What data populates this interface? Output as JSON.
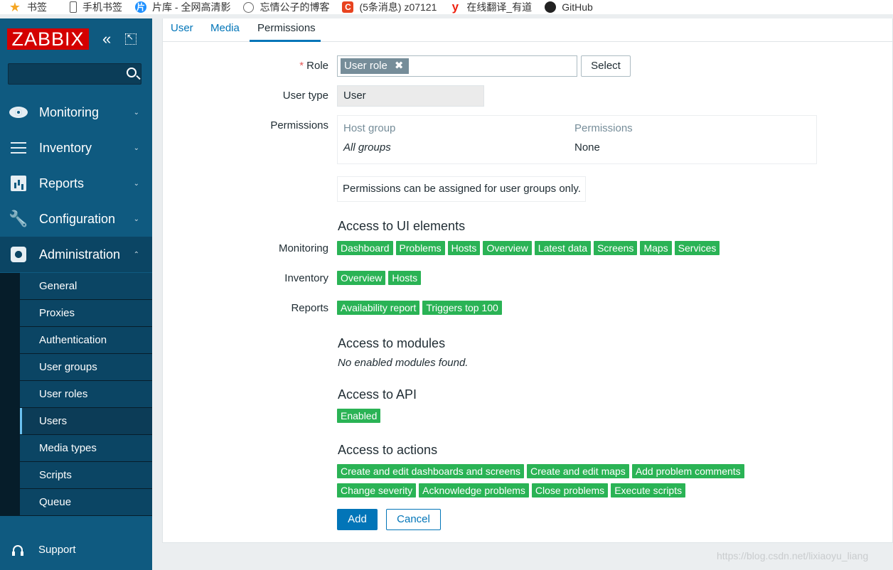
{
  "bookmarks": [
    {
      "label": "书签",
      "icon": "star-icon"
    },
    {
      "label": "手机书签",
      "icon": "phone-icon"
    },
    {
      "label": "片库 - 全网高清影",
      "icon": "piankul-icon"
    },
    {
      "label": "忘情公子的博客",
      "icon": "globe-icon"
    },
    {
      "label": "(5条消息) z07121",
      "icon": "csdn-icon"
    },
    {
      "label": "在线翻译_有道",
      "icon": "youdao-icon"
    },
    {
      "label": "GitHub",
      "icon": "github-icon"
    }
  ],
  "sidebar": {
    "logo": "ZABBIX",
    "collapse_glyph": "«",
    "menu": [
      {
        "label": "Monitoring",
        "icon": "eye-icon"
      },
      {
        "label": "Inventory",
        "icon": "list-icon"
      },
      {
        "label": "Reports",
        "icon": "bar-chart-icon"
      },
      {
        "label": "Configuration",
        "icon": "wrench-icon"
      },
      {
        "label": "Administration",
        "icon": "gear-icon"
      }
    ],
    "chevron_down": "⌄",
    "chevron_up": "⌃",
    "submenu": [
      "General",
      "Proxies",
      "Authentication",
      "User groups",
      "User roles",
      "Users",
      "Media types",
      "Scripts",
      "Queue"
    ],
    "selected_submenu": "Users",
    "support": "Support"
  },
  "tabs": [
    "User",
    "Media",
    "Permissions"
  ],
  "active_tab": "Permissions",
  "form": {
    "role_label": "Role",
    "role_required": "*",
    "role_value": "User role",
    "role_remove": "✖",
    "select_button": "Select",
    "user_type_label": "User type",
    "user_type_value": "User",
    "permissions_label": "Permissions",
    "perm_headers": [
      "Host group",
      "Permissions"
    ],
    "perm_row": [
      "All groups",
      "None"
    ],
    "note": "Permissions can be assigned for user groups only."
  },
  "ui_access": {
    "title": "Access to UI elements",
    "monitoring_label": "Monitoring",
    "monitoring": [
      "Dashboard",
      "Problems",
      "Hosts",
      "Overview",
      "Latest data",
      "Screens",
      "Maps",
      "Services"
    ],
    "inventory_label": "Inventory",
    "inventory": [
      "Overview",
      "Hosts"
    ],
    "reports_label": "Reports",
    "reports": [
      "Availability report",
      "Triggers top 100"
    ]
  },
  "modules": {
    "title": "Access to modules",
    "text": "No enabled modules found."
  },
  "api": {
    "title": "Access to API",
    "status": "Enabled"
  },
  "actions": {
    "title": "Access to actions",
    "row1": [
      "Create and edit dashboards and screens",
      "Create and edit maps",
      "Add problem comments"
    ],
    "row2": [
      "Change severity",
      "Acknowledge problems",
      "Close problems",
      "Execute scripts"
    ]
  },
  "buttons": {
    "add": "Add",
    "cancel": "Cancel"
  },
  "watermark": "https://blog.csdn.net/lixiaoyu_liang",
  "colors": {
    "sidebar": "#0f5a80",
    "tag_green": "#2ab355",
    "link_blue": "#0275b8",
    "logo_red": "#d40000"
  }
}
